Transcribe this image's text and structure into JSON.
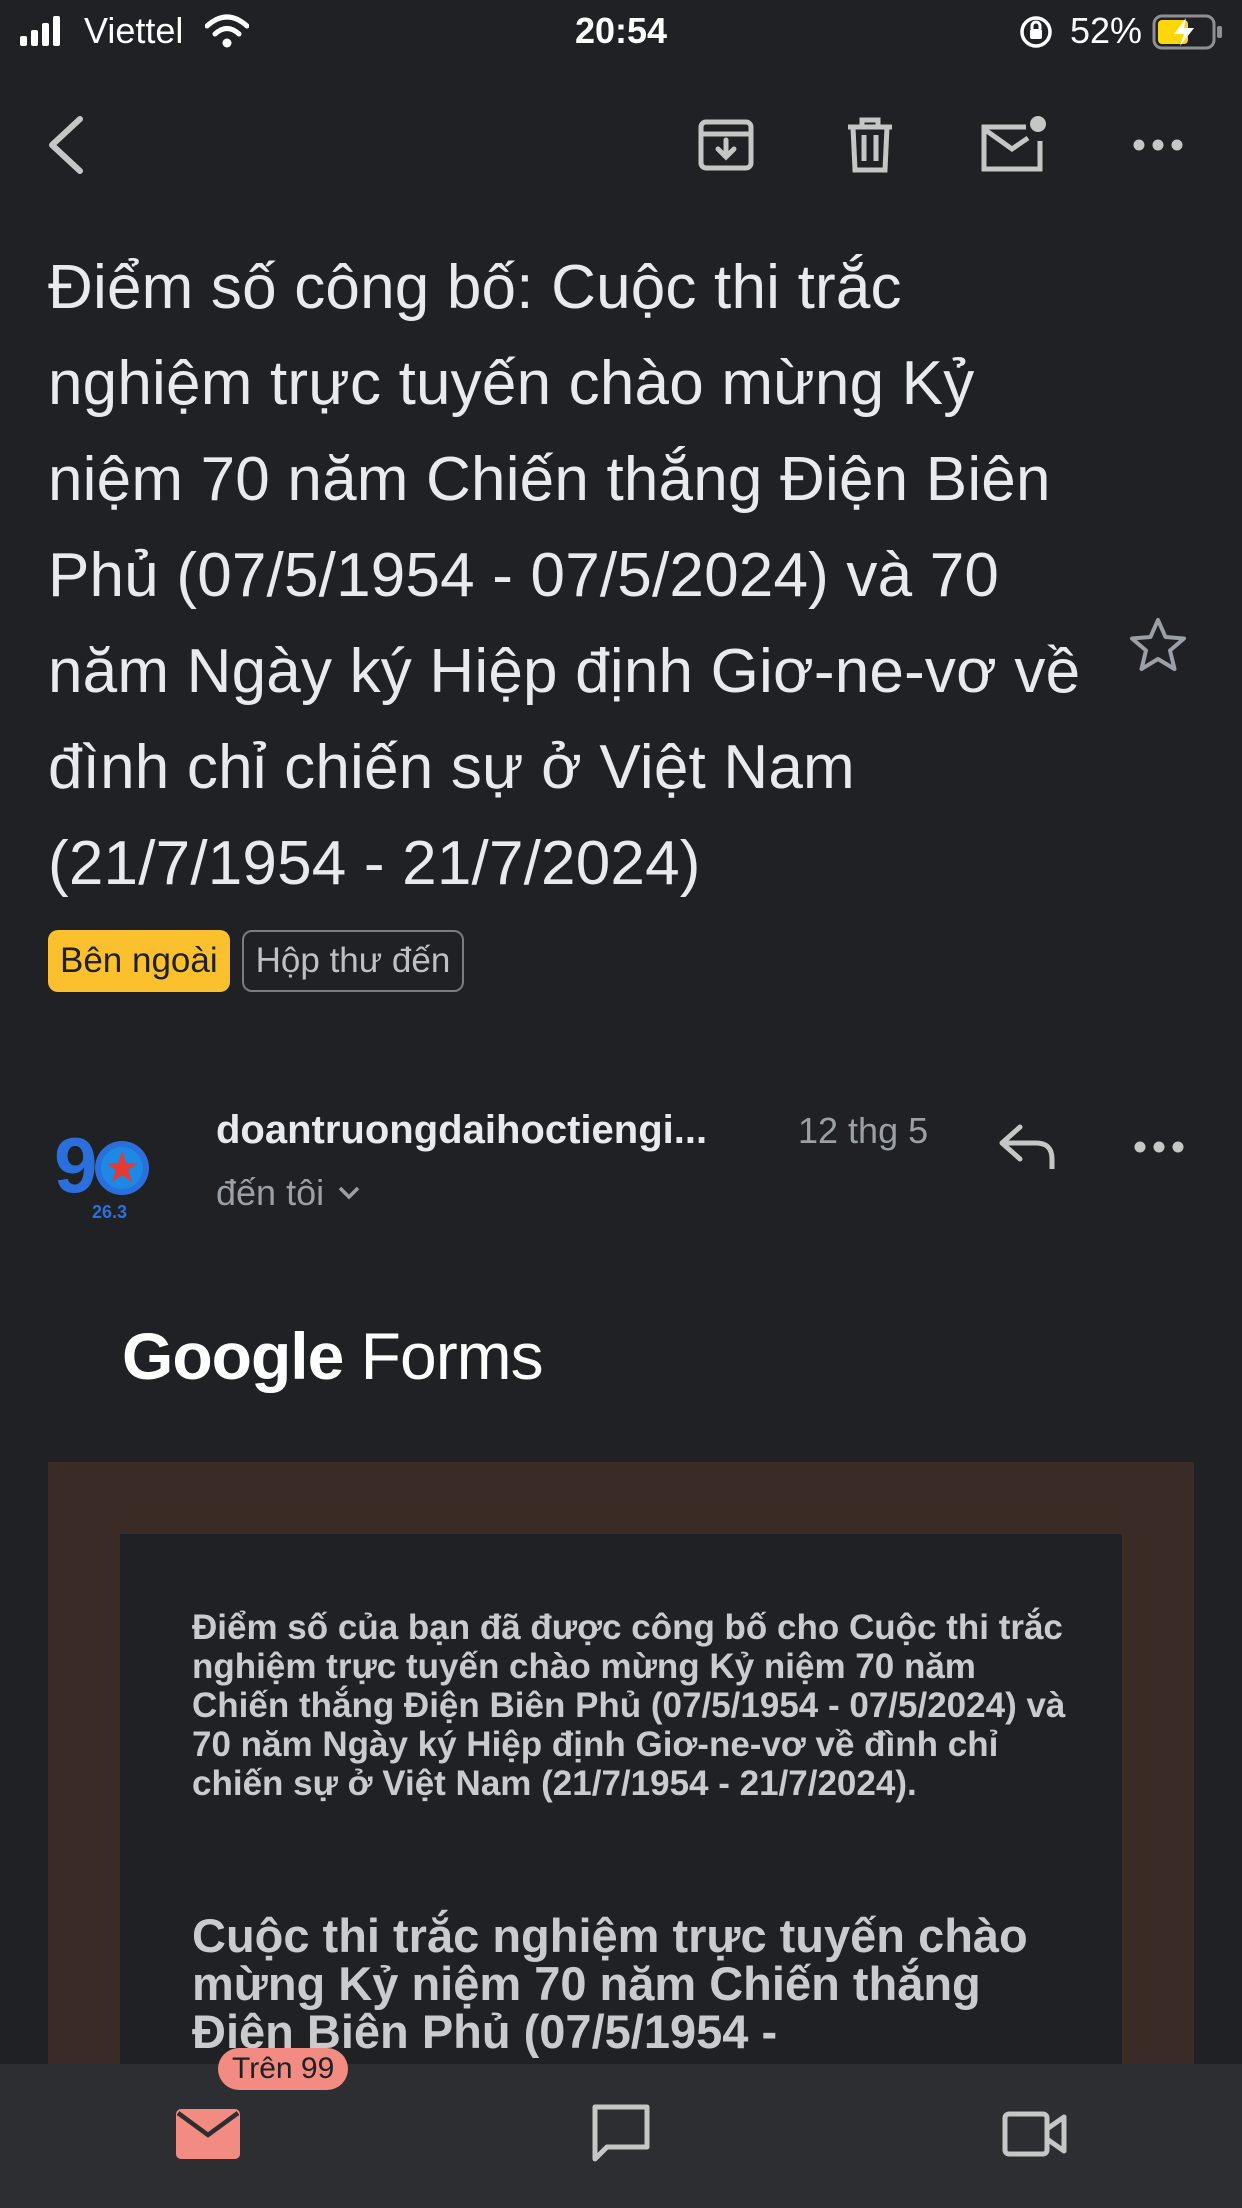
{
  "status_bar": {
    "carrier": "Viettel",
    "time": "20:54",
    "battery": "52%"
  },
  "toolbar": {
    "back_icon": "back-arrow-icon",
    "archive_icon": "archive-icon",
    "delete_icon": "trash-icon",
    "unread_icon": "mark-unread-icon",
    "more_icon": "more-horizontal-icon"
  },
  "email": {
    "subject": "Điểm số công bố: Cuộc thi trắc nghiệm trực tuyến chào mừng Kỷ niệm 70 năm Chiến thắng Điện Biên Phủ (07/5/1954 - 07/5/2024) và 70 năm Ngày ký Hiệp định Giơ-ne-vơ về đình chỉ chiến sự ở Việt Nam (21/7/1954 - 21/7/2024)",
    "labels": [
      "Bên ngoài",
      "Hộp thư đến"
    ],
    "sender": "doantruongdaihoctiengi...",
    "date": "12 thg 5",
    "recipient": "đến tôi",
    "avatar_text": "26.3"
  },
  "body": {
    "brand_google": "Google",
    "brand_forms": "Forms",
    "intro": "Điểm số của bạn đã được công bố cho Cuộc thi trắc nghiệm trực tuyến chào mừng Kỷ niệm 70 năm Chiến thắng Điện Biên Phủ (07/5/1954 - 07/5/2024) và 70 năm Ngày ký Hiệp định Giơ-ne-vơ về đình chỉ chiến sự ở Việt Nam (21/7/1954 - 21/7/2024).",
    "heading": "Cuộc thi trắc nghiệm trực tuyến chào mừng Kỷ niệm 70 năm Chiến thắng Điện Biên Phủ (07/5/1954 -"
  },
  "bottom_nav": {
    "mail_badge": "Trên 99",
    "accent": "#f28b82",
    "label_color": "#fbc02d"
  }
}
